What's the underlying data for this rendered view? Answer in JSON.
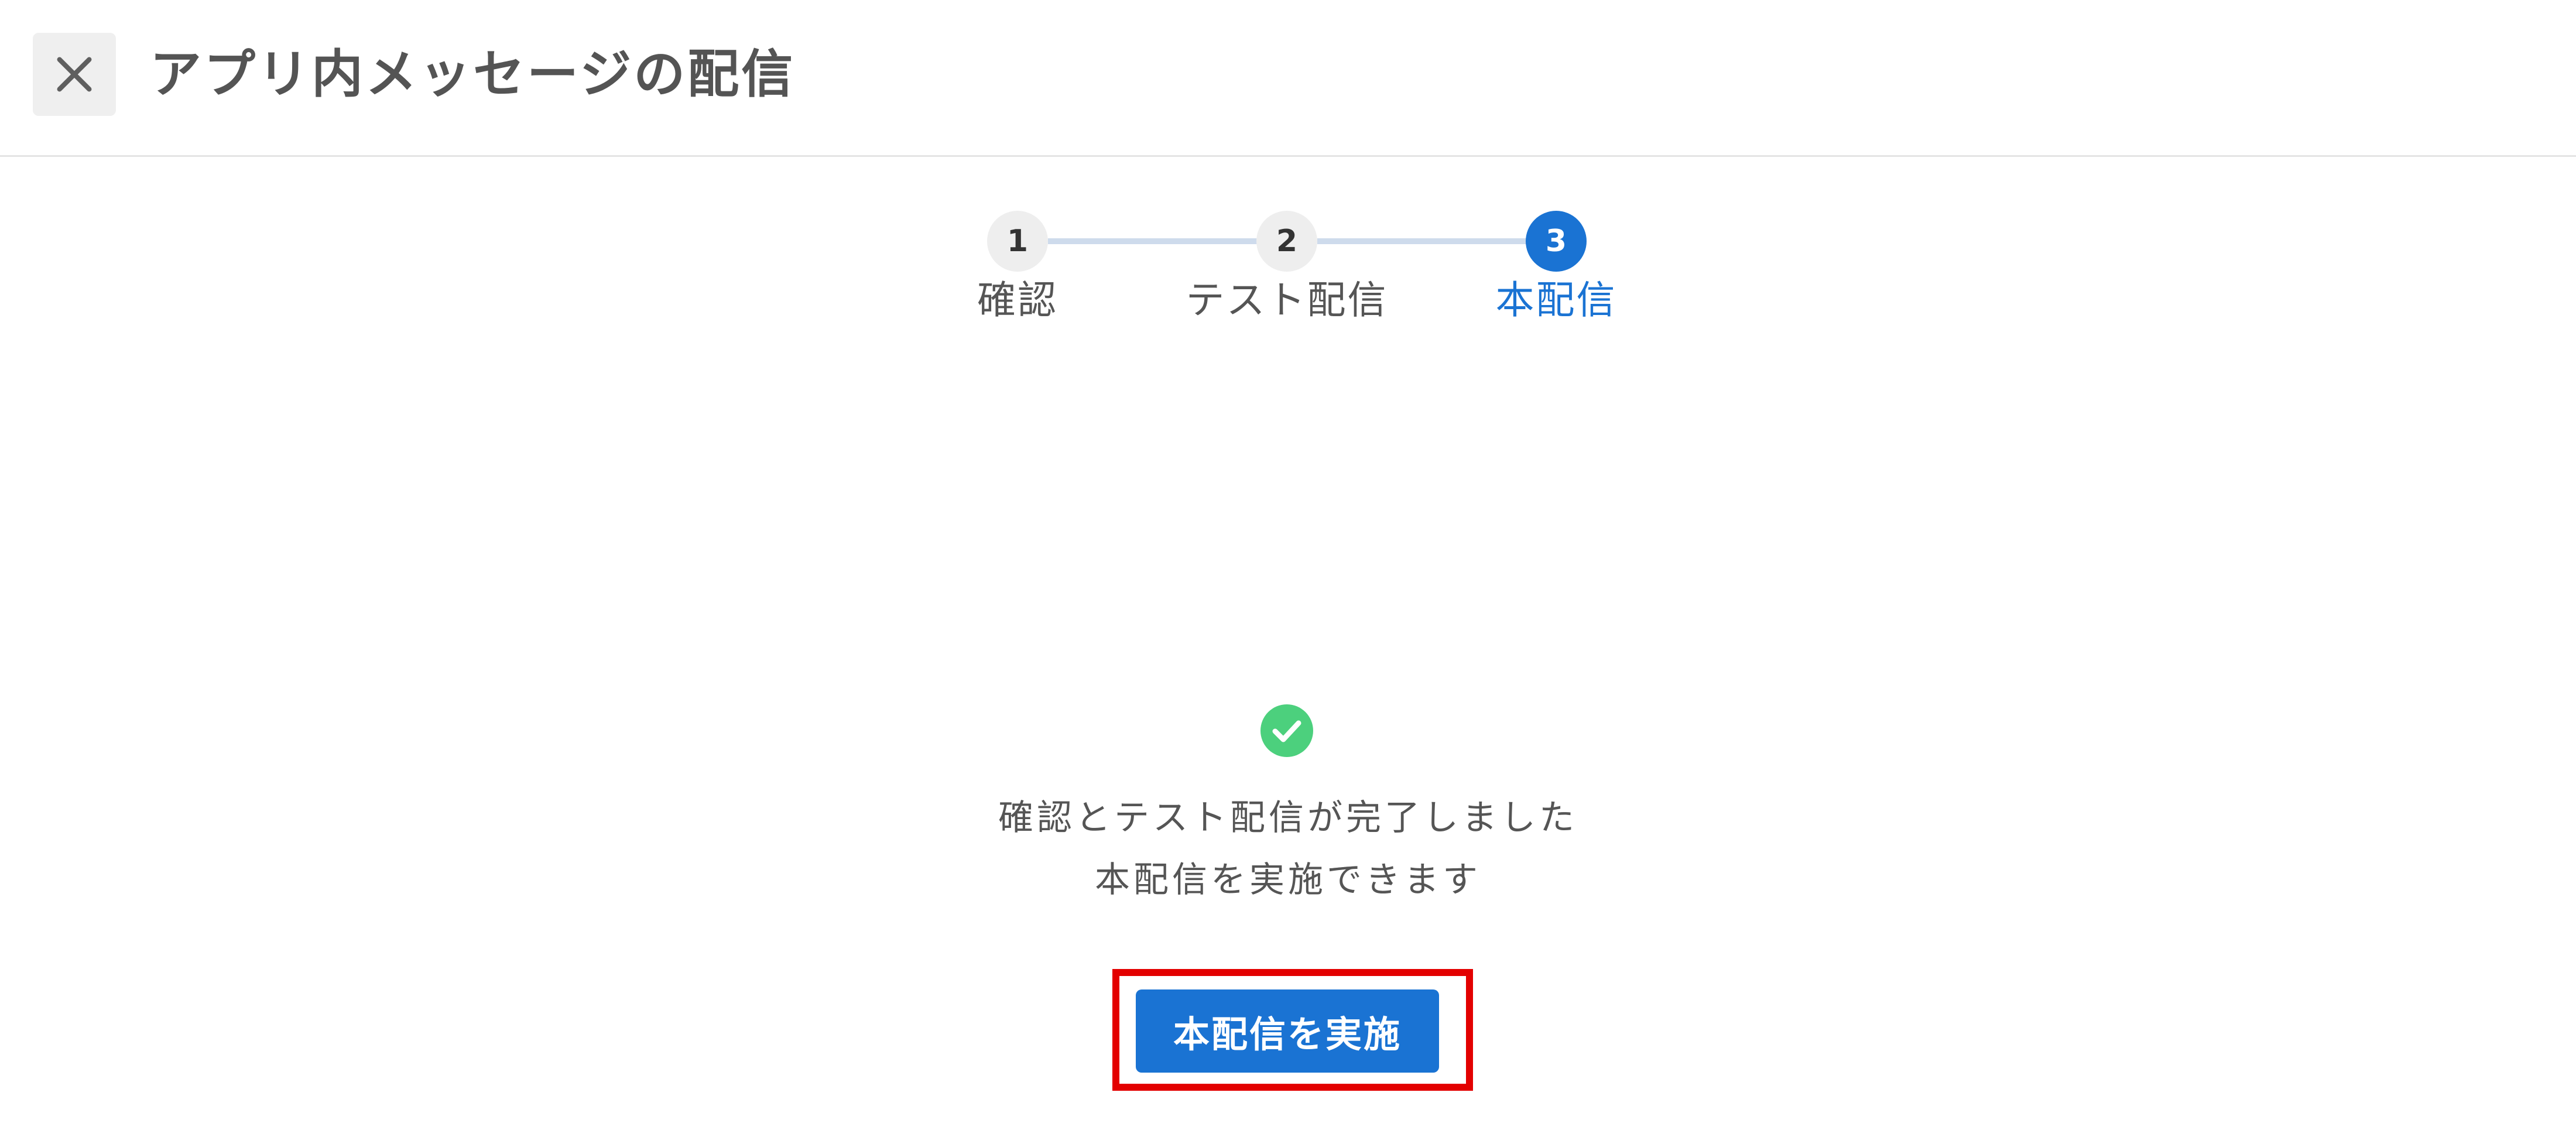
{
  "header": {
    "title": "アプリ内メッセージの配信",
    "close_icon": "close-icon"
  },
  "stepper": {
    "current_step": 3,
    "steps": [
      {
        "number": "1",
        "label": "確認",
        "state": "done"
      },
      {
        "number": "2",
        "label": "テスト配信",
        "state": "done"
      },
      {
        "number": "3",
        "label": "本配信",
        "state": "active"
      }
    ]
  },
  "completion": {
    "icon": "check-circle-icon",
    "message_line1": "確認とテスト配信が完了しました",
    "message_line2": "本配信を実施できます"
  },
  "action": {
    "button_label": "本配信を実施"
  },
  "colors": {
    "accent": "#1a73d3",
    "success": "#4cd07d",
    "highlight": "#e30000",
    "step_inactive": "#eeeeee",
    "step_line": "#cedbec"
  }
}
